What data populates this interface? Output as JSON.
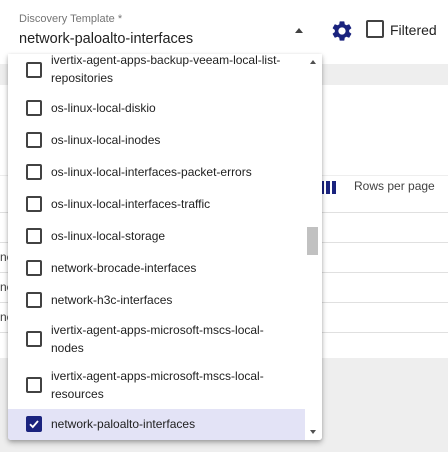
{
  "select": {
    "label": "Discovery Template *",
    "value": "network-paloalto-interfaces"
  },
  "toolbar": {
    "filtered_label": "Filtered",
    "gear_icon": "gear-icon",
    "accent_color": "#1a237e"
  },
  "table": {
    "rows_per_page_label": "Rows per page",
    "row_fragments": [
      "ne",
      "ne",
      "ne"
    ]
  },
  "menu": {
    "items": [
      {
        "label": "ivertix-agent-apps-backup-veeam-local-list-repositories",
        "checked": false
      },
      {
        "label": "os-linux-local-diskio",
        "checked": false
      },
      {
        "label": "os-linux-local-inodes",
        "checked": false
      },
      {
        "label": "os-linux-local-interfaces-packet-errors",
        "checked": false
      },
      {
        "label": "os-linux-local-interfaces-traffic",
        "checked": false
      },
      {
        "label": "os-linux-local-storage",
        "checked": false
      },
      {
        "label": "network-brocade-interfaces",
        "checked": false
      },
      {
        "label": "network-h3c-interfaces",
        "checked": false
      },
      {
        "label": "ivertix-agent-apps-microsoft-mscs-local-nodes",
        "checked": false
      },
      {
        "label": "ivertix-agent-apps-microsoft-mscs-local-resources",
        "checked": false
      },
      {
        "label": "network-paloalto-interfaces",
        "checked": true
      }
    ]
  }
}
